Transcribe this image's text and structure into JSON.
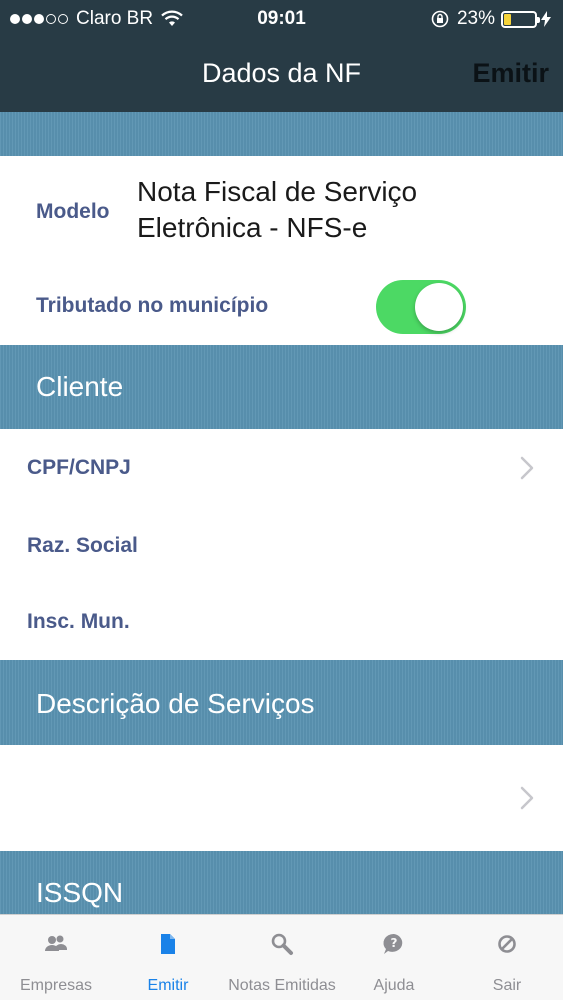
{
  "status_bar": {
    "carrier": "Claro BR",
    "time": "09:01",
    "battery_percent": "23%",
    "battery_level": 0.23,
    "signal_bars_filled": 3,
    "signal_bars_total": 5
  },
  "navbar": {
    "title": "Dados da NF",
    "action": "Emitir"
  },
  "nf": {
    "modelo_label": "Modelo",
    "modelo_value_line1": "Nota Fiscal de Serviço",
    "modelo_value_line2": "Eletrônica - NFS-e",
    "tributado_label": "Tributado no município",
    "tributado_on": true
  },
  "cliente": {
    "header": "Cliente",
    "cpf_label": "CPF/CNPJ",
    "razao_label": "Raz. Social",
    "insc_label": "Insc. Mun."
  },
  "servicos": {
    "header": "Descrição de Serviços"
  },
  "issqn": {
    "header": "ISSQN"
  },
  "tabbar": {
    "tabs": [
      {
        "label": "Empresas",
        "icon": "people-icon"
      },
      {
        "label": "Emitir",
        "icon": "document-icon"
      },
      {
        "label": "Notas Emitidas",
        "icon": "magnifier-icon"
      },
      {
        "label": "Ajuda",
        "icon": "help-bubble-icon"
      },
      {
        "label": "Sair",
        "icon": "no-entry-icon"
      }
    ],
    "active_index": 1
  },
  "colors": {
    "header_bg": "#283b45",
    "section_band": "#5a93b1",
    "label_text": "#4a5a8a",
    "toggle_on": "#4cd964",
    "tab_active": "#1a82e8",
    "tab_inactive": "#8e8e93"
  }
}
